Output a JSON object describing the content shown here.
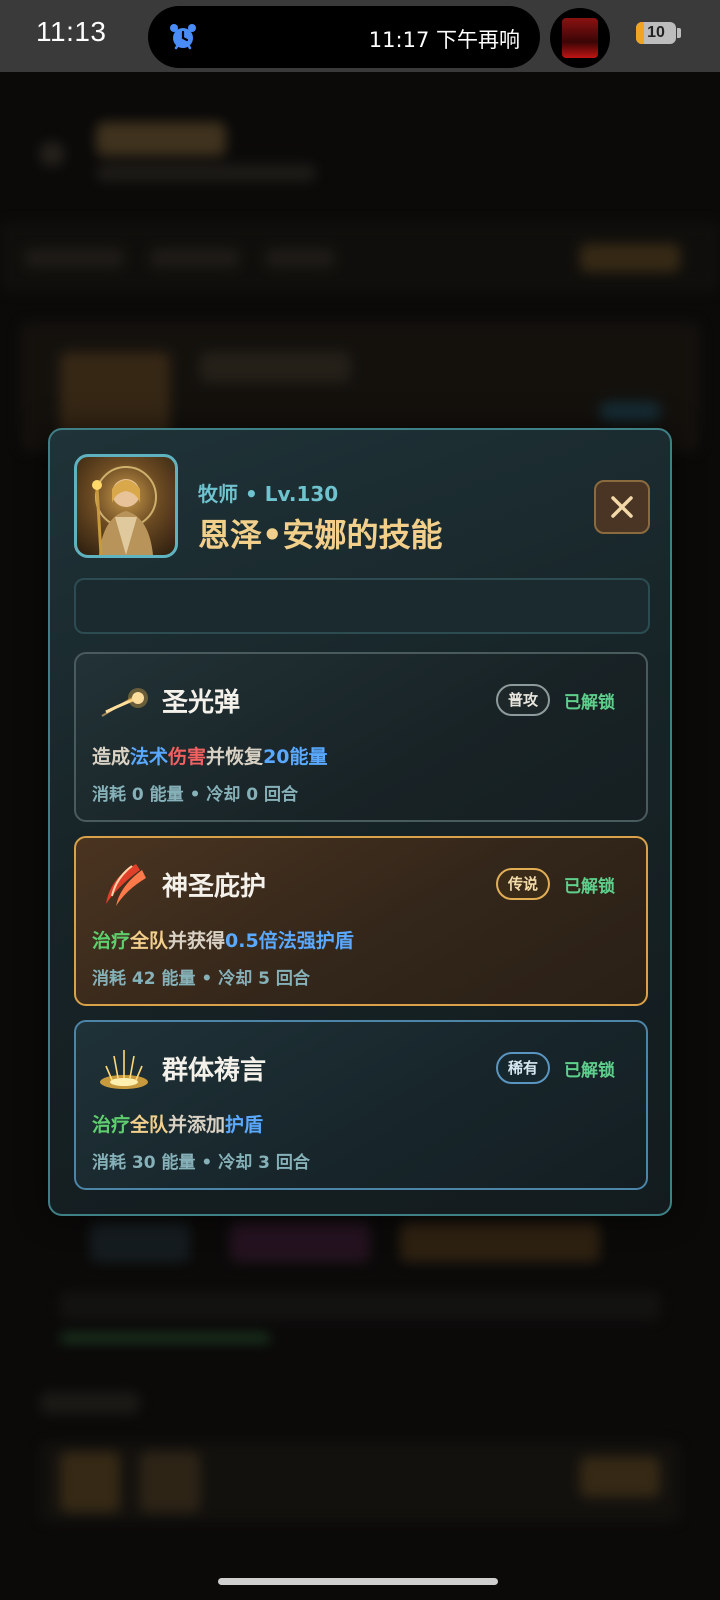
{
  "status_bar": {
    "time": "11:13",
    "alarm_text": "11:17 下午再响",
    "battery": "10"
  },
  "dialog": {
    "subtitle": "牧师 • Lv.130",
    "title": "恩泽•安娜的技能",
    "skills": [
      {
        "name": "圣光弹",
        "badge": "普攻",
        "status": "已解锁",
        "desc": [
          "造成",
          "法术",
          "伤害",
          "并恢复",
          "20能量"
        ],
        "meta": "消耗 0 能量 • 冷却 0 回合"
      },
      {
        "name": "神圣庇护",
        "badge": "传说",
        "status": "已解锁",
        "desc": [
          "治疗",
          "全队",
          "并获得",
          "0.5倍法强护盾"
        ],
        "meta": "消耗 42 能量 • 冷却 5 回合"
      },
      {
        "name": "群体祷言",
        "badge": "稀有",
        "status": "已解锁",
        "desc": [
          "治疗",
          "全队",
          "并添加",
          "护盾"
        ],
        "meta": "消耗 30 能量 • 冷却 3 回合"
      }
    ]
  },
  "colors": {
    "accent_teal": "#6fc3cf",
    "title_gold": "#f2cf8a",
    "unlocked_green": "#5fd08c",
    "legend_border": "#d9a14a",
    "rare_border": "#4c85a8"
  },
  "icons": [
    "alarm-icon",
    "app-icon",
    "battery-icon",
    "close-icon",
    "holy-bolt-icon",
    "divine-shield-icon",
    "mass-prayer-icon"
  ]
}
